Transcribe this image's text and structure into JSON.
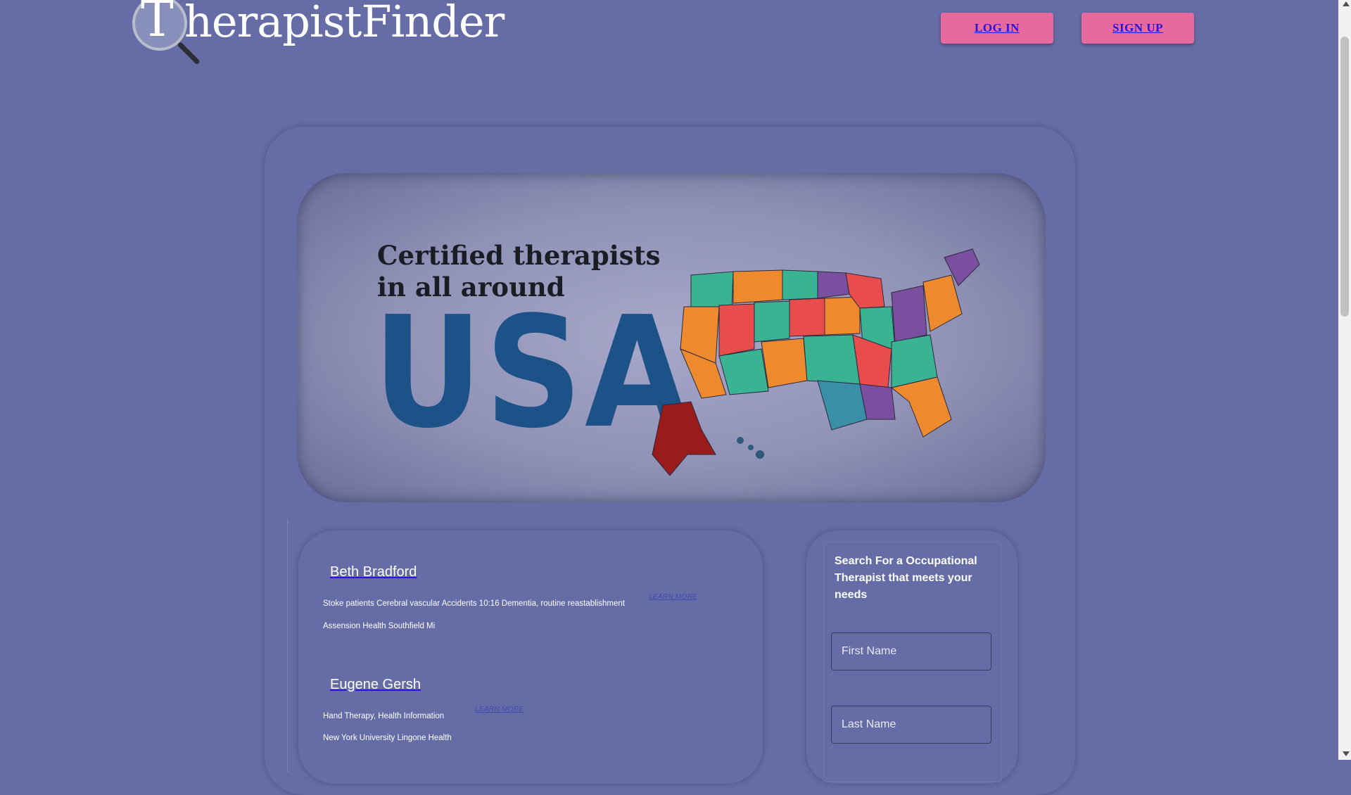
{
  "header": {
    "logo_initial": "T",
    "logo_rest": "herapistFinder",
    "login_label": "LOG IN",
    "signup_label": "SIGN UP"
  },
  "hero": {
    "line1": "Certified therapists",
    "line2": "in all around",
    "country": "USA",
    "map_icon": "usa-map-icon"
  },
  "therapists": [
    {
      "name": "Beth Bradford",
      "specialties": "Stoke patients Cerebral vascular Accidents 10:16 Dementia, routine reastablishment",
      "location": "Assension Health Southfield Mi",
      "learn_more": "LEARN MORE"
    },
    {
      "name": "Eugene Gersh",
      "specialties": "Hand Therapy, Health Information",
      "location": "New York University Lingone Health",
      "learn_more": "LEARN MORE"
    }
  ],
  "search": {
    "title": "Search For a Occupational Therapist that meets your needs",
    "first_name_placeholder": "First Name",
    "last_name_placeholder": "Last Name"
  },
  "colors": {
    "background": "#656ca6",
    "button": "#e76a9f",
    "button_text": "#2a12d6",
    "usa_text": "#1d5289"
  }
}
